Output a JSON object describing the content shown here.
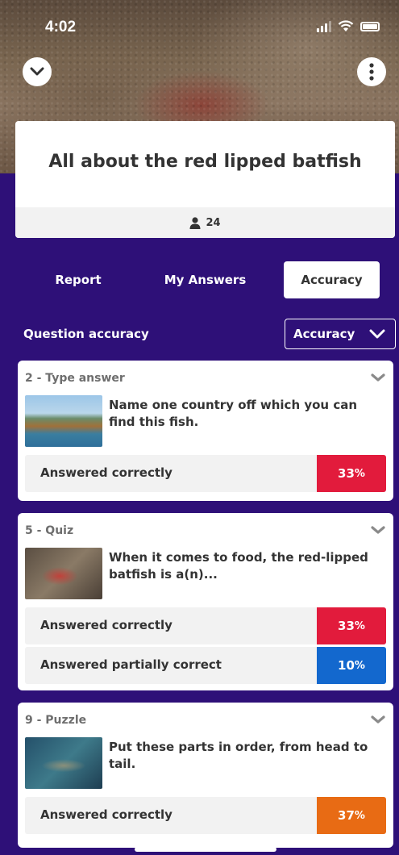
{
  "status_bar": {
    "time": "4:02"
  },
  "quiz": {
    "title": "All about the red lipped batfish",
    "player_count": "24"
  },
  "tabs": [
    {
      "label": "Report",
      "active": false
    },
    {
      "label": "My Answers",
      "active": false
    },
    {
      "label": "Accuracy",
      "active": true
    }
  ],
  "section": {
    "title": "Question accuracy",
    "dropdown_label": "Accuracy"
  },
  "questions": [
    {
      "header": "2 - Type answer",
      "text": "Name one country off which you can find this fish.",
      "answers": [
        {
          "label": "Answered correctly",
          "percent": "33",
          "color": "#e21b3c"
        }
      ]
    },
    {
      "header": "5 - Quiz",
      "text": "When it comes to food, the red-lipped batfish is a(n)...",
      "answers": [
        {
          "label": "Answered correctly",
          "percent": "33",
          "color": "#e21b3c"
        },
        {
          "label": "Answered partially correct",
          "percent": "10",
          "color": "#1368ce"
        }
      ]
    },
    {
      "header": "9 - Puzzle",
      "text": "Put these parts in order, from head to tail.",
      "answers": [
        {
          "label": "Answered correctly",
          "percent": "37",
          "color": "#e86b14"
        }
      ]
    }
  ],
  "colors": {
    "background": "#2e1078",
    "card": "#ffffff",
    "row": "#f2f2f2"
  }
}
